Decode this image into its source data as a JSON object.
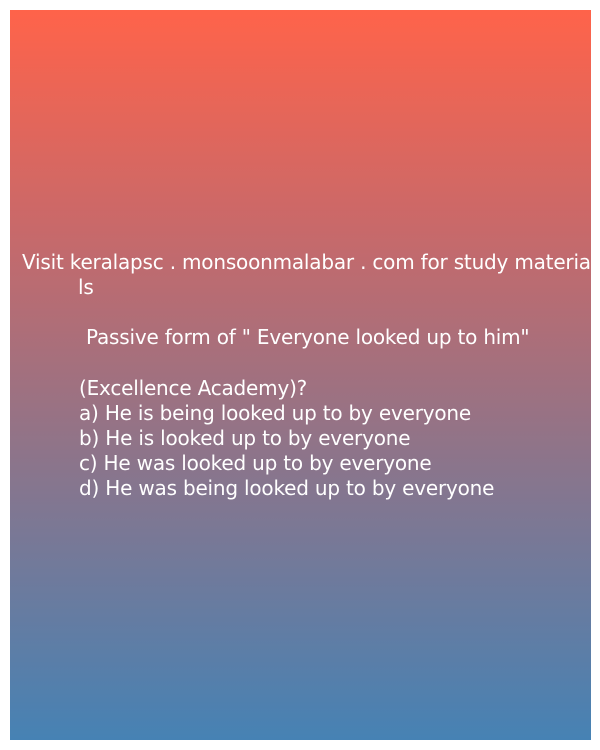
{
  "visit_line_1": "Visit keralapsc . monsoonmalabar . com for study materia",
  "visit_line_2": "ls",
  "question": "Passive form of \" Everyone looked up to him\"",
  "source": "(Excellence Academy)?",
  "options": [
    "a) He is being looked up to by everyone",
    "b) He is looked up to by everyone",
    "c) He was looked up to by everyone",
    "d) He was being looked up to by everyone"
  ],
  "colors": {
    "gradient_top": "#ff634a",
    "gradient_bottom": "#4682b4",
    "text": "#ffffff"
  }
}
